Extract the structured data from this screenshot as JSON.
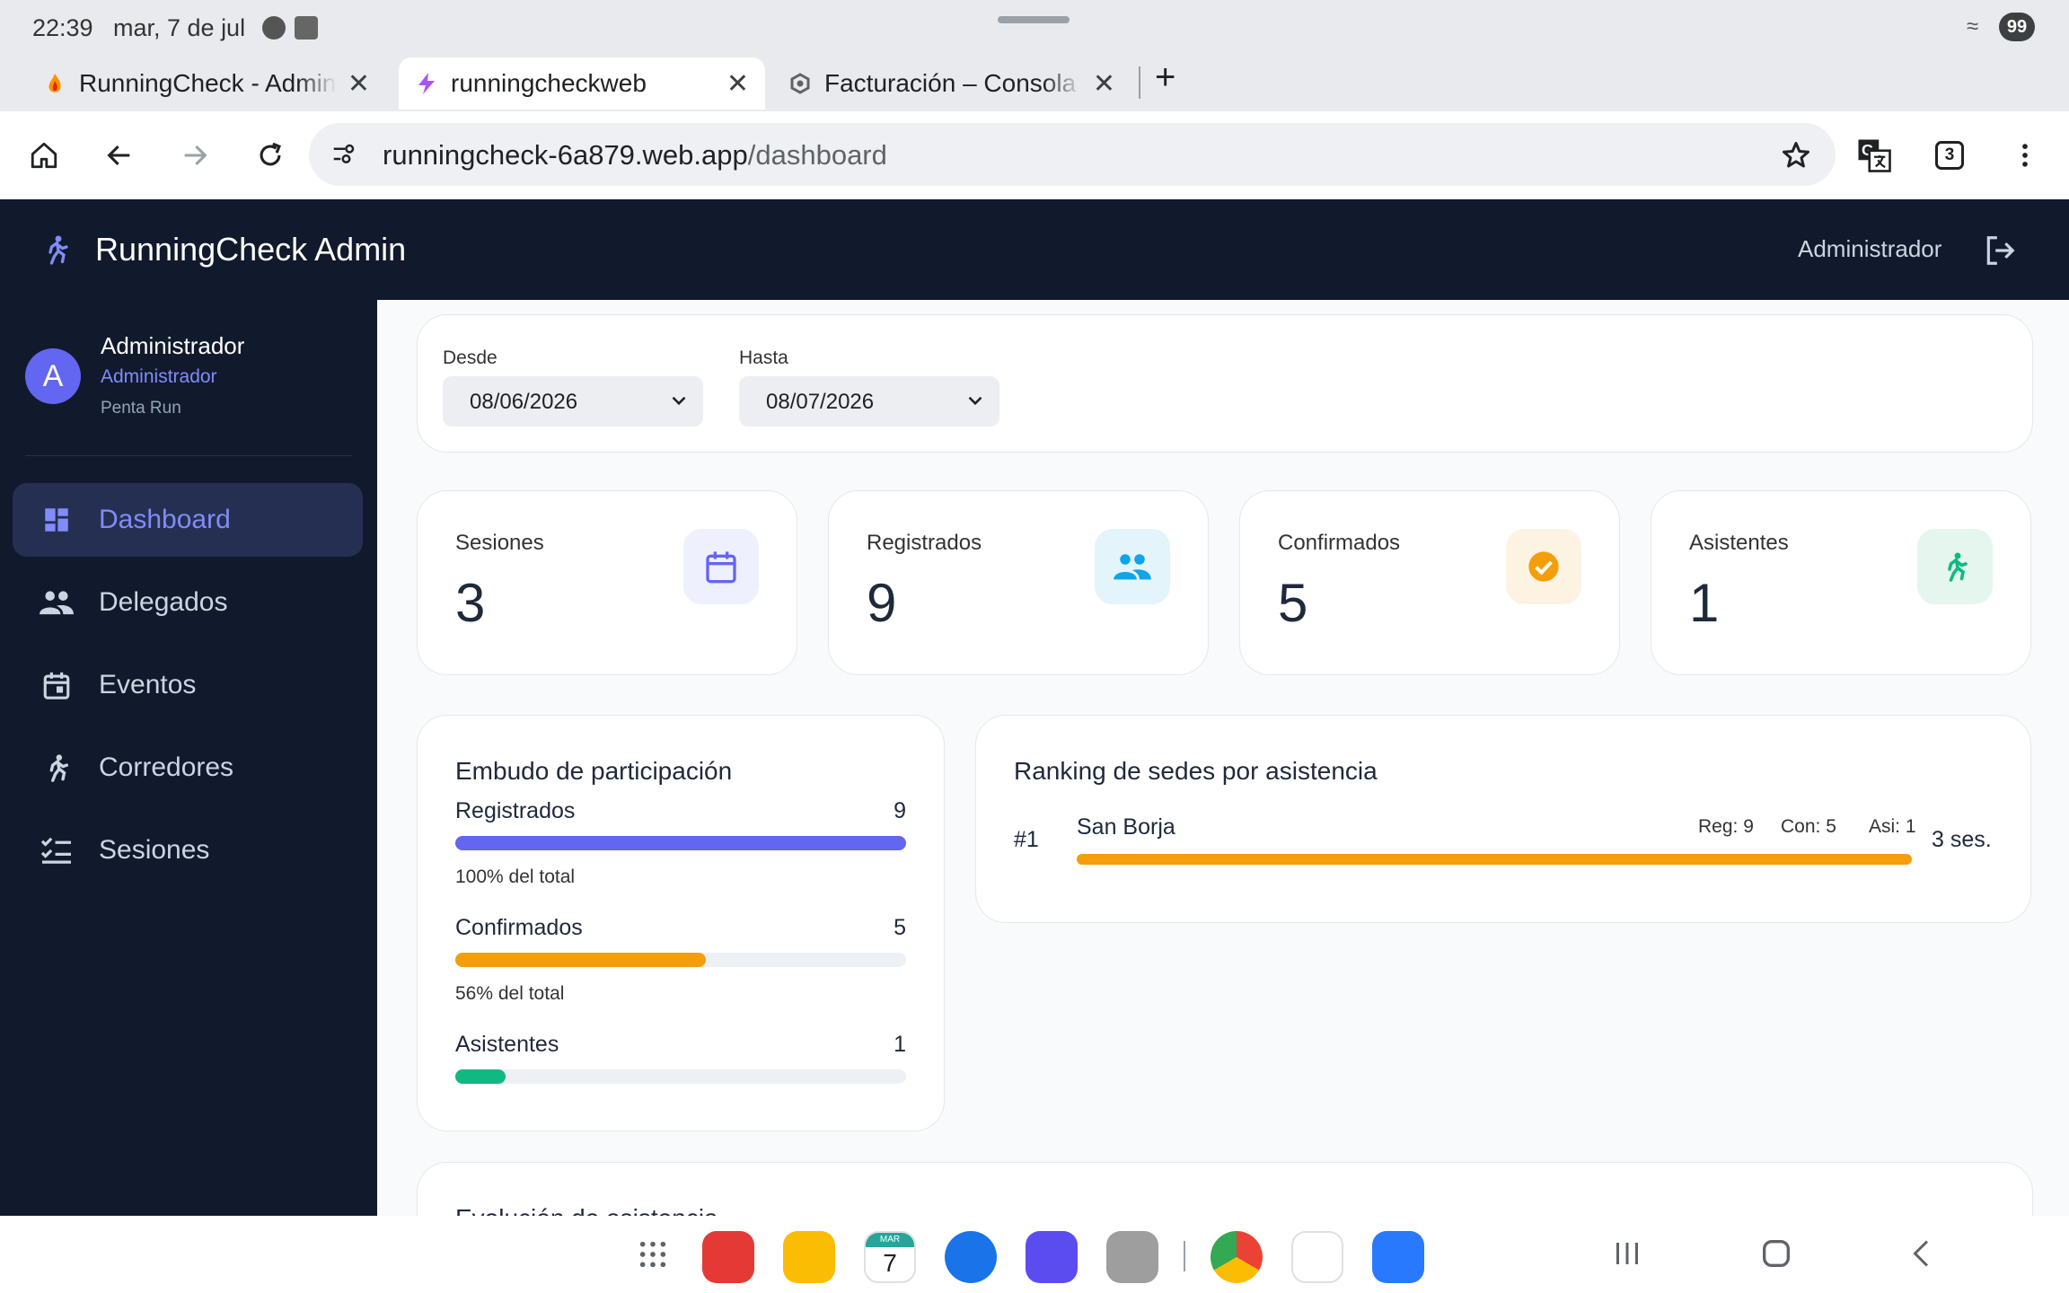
{
  "status_bar": {
    "time": "22:39",
    "date": "mar, 7 de jul",
    "battery": "99"
  },
  "tabs": [
    {
      "title": "RunningCheck - Administ",
      "active": false
    },
    {
      "title": "runningcheckweb",
      "active": true
    },
    {
      "title": "Facturación – Consola de",
      "active": false
    }
  ],
  "tab_count": "3",
  "url": {
    "domain": "runningcheck-6a879.web.app",
    "path": "/dashboard"
  },
  "app": {
    "title": "RunningCheck Admin",
    "header_user": "Administrador"
  },
  "sidebar": {
    "user": {
      "initial": "A",
      "name": "Administrador",
      "role": "Administrador",
      "org": "Penta Run"
    },
    "items": [
      {
        "label": "Dashboard",
        "icon": "dashboard-icon",
        "active": true
      },
      {
        "label": "Delegados",
        "icon": "people-icon"
      },
      {
        "label": "Eventos",
        "icon": "calendar-icon"
      },
      {
        "label": "Corredores",
        "icon": "runner-icon"
      },
      {
        "label": "Sesiones",
        "icon": "checklist-icon"
      }
    ]
  },
  "filters": {
    "from_label": "Desde",
    "from_value": "08/06/2026",
    "to_label": "Hasta",
    "to_value": "08/07/2026"
  },
  "stats": [
    {
      "label": "Sesiones",
      "value": "3",
      "icon": "calendar-icon",
      "bg": "#eef0fd",
      "color": "#6366f1"
    },
    {
      "label": "Registrados",
      "value": "9",
      "icon": "people-icon",
      "bg": "#e3f4fb",
      "color": "#0ea5e9"
    },
    {
      "label": "Confirmados",
      "value": "5",
      "icon": "check-circle-icon",
      "bg": "#fdf3e3",
      "color": "#f59e0b"
    },
    {
      "label": "Asistentes",
      "value": "1",
      "icon": "runner-icon",
      "bg": "#e4f6ee",
      "color": "#10b981"
    }
  ],
  "funnel": {
    "title": "Embudo de participación",
    "rows": [
      {
        "label": "Registrados",
        "value": "9",
        "fraction": 1.0,
        "pct_text": "100% del total",
        "color": "#6366f1"
      },
      {
        "label": "Confirmados",
        "value": "5",
        "fraction": 0.556,
        "pct_text": "56% del total",
        "color": "#f59e0b"
      },
      {
        "label": "Asistentes",
        "value": "1",
        "fraction": 0.111,
        "pct_text": "",
        "color": "#10b981"
      }
    ]
  },
  "ranking": {
    "title": "Ranking de sedes por asistencia",
    "rows": [
      {
        "rank": "#1",
        "name": "San Borja",
        "reg": "Reg: 9",
        "con": "Con: 5",
        "asi": "Asi: 1",
        "sessions": "3 ses.",
        "fraction": 1.0,
        "color": "#f59e0b"
      }
    ]
  },
  "next_section_title": "Evolución de asistencia",
  "dock": {
    "calendar_month": "MAR",
    "calendar_day": "7"
  }
}
